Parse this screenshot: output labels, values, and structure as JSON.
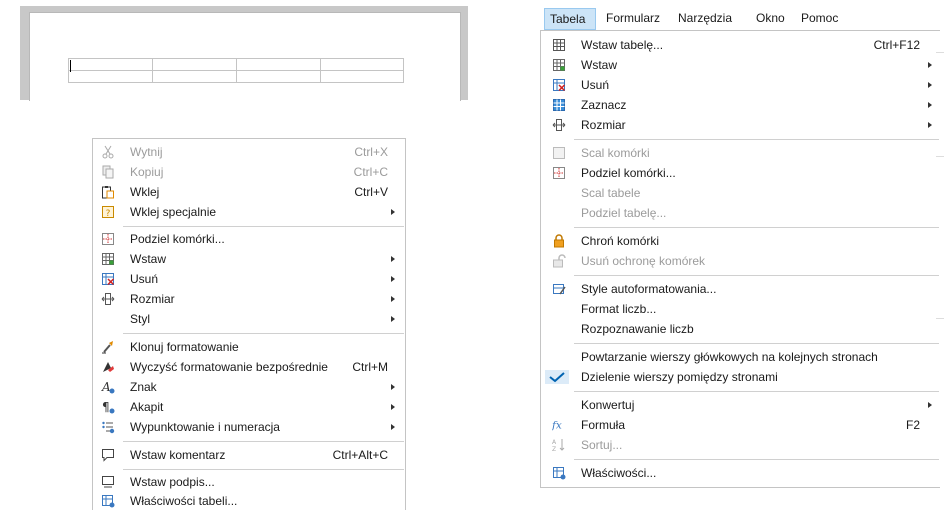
{
  "menubar": {
    "items": [
      {
        "label": "Tabela",
        "active": true
      },
      {
        "label": "Formularz"
      },
      {
        "label": "Narzędzia"
      },
      {
        "label": "Okno"
      },
      {
        "label": "Pomoc"
      }
    ]
  },
  "context_menu": {
    "items": [
      {
        "label": "Wytnij",
        "shortcut": "Ctrl+X",
        "icon": "scissors-icon",
        "disabled": true
      },
      {
        "label": "Kopiuj",
        "shortcut": "Ctrl+C",
        "icon": "copy-icon",
        "disabled": true
      },
      {
        "label": "Wklej",
        "shortcut": "Ctrl+V",
        "icon": "paste-icon"
      },
      {
        "label": "Wklej specjalnie",
        "icon": "paste-special-icon",
        "submenu": true
      },
      {
        "label": "Podziel komórki...",
        "icon": "split-cells-icon"
      },
      {
        "label": "Wstaw",
        "icon": "insert-table-icon",
        "submenu": true
      },
      {
        "label": "Usuń",
        "icon": "delete-table-icon",
        "submenu": true
      },
      {
        "label": "Rozmiar",
        "icon": "resize-icon",
        "submenu": true
      },
      {
        "label": "Styl",
        "submenu": true
      },
      {
        "label": "Klonuj formatowanie",
        "icon": "clone-brush-icon"
      },
      {
        "label": "Wyczyść formatowanie bezpośrednie",
        "shortcut": "Ctrl+M",
        "icon": "clear-format-icon"
      },
      {
        "label": "Znak",
        "icon": "character-icon",
        "submenu": true
      },
      {
        "label": "Akapit",
        "icon": "paragraph-icon",
        "submenu": true
      },
      {
        "label": "Wypunktowanie i numeracja",
        "icon": "bullets-icon",
        "submenu": true
      },
      {
        "label": "Wstaw komentarz",
        "shortcut": "Ctrl+Alt+C",
        "icon": "comment-icon"
      },
      {
        "label": "Wstaw podpis...",
        "icon": "caption-icon"
      },
      {
        "label": "Właściwości tabeli...",
        "icon": "table-properties-icon"
      }
    ]
  },
  "table_menu": {
    "items": [
      {
        "label": "Wstaw tabelę...",
        "shortcut": "Ctrl+F12",
        "icon": "table-icon"
      },
      {
        "label": "Wstaw",
        "icon": "insert-table-icon",
        "submenu": true
      },
      {
        "label": "Usuń",
        "icon": "delete-table-icon",
        "submenu": true
      },
      {
        "label": "Zaznacz",
        "icon": "select-table-icon",
        "submenu": true
      },
      {
        "label": "Rozmiar",
        "icon": "resize-icon",
        "submenu": true
      },
      {
        "label": "Scal komórki",
        "icon": "merge-cells-icon",
        "disabled": true
      },
      {
        "label": "Podziel komórki...",
        "icon": "split-cells-icon"
      },
      {
        "label": "Scal tabele",
        "disabled": true
      },
      {
        "label": "Podziel tabelę...",
        "disabled": true
      },
      {
        "label": "Chroń komórki",
        "icon": "lock-icon"
      },
      {
        "label": "Usuń ochronę komórek",
        "icon": "unlock-icon",
        "disabled": true
      },
      {
        "label": "Style autoformatowania...",
        "icon": "autoformat-icon"
      },
      {
        "label": "Format liczb..."
      },
      {
        "label": "Rozpoznawanie liczb"
      },
      {
        "label": "Powtarzanie wierszy główkowych na kolejnych stronach"
      },
      {
        "label": "Dzielenie wierszy pomiędzy stronami",
        "icon": "checkmark-icon",
        "checked": true
      },
      {
        "label": "Konwertuj",
        "submenu": true
      },
      {
        "label": "Formuła",
        "shortcut": "F2",
        "icon": "fx-icon"
      },
      {
        "label": "Sortuj...",
        "icon": "sort-icon",
        "disabled": true
      },
      {
        "label": "Właściwości...",
        "icon": "table-properties-icon"
      }
    ]
  },
  "colors": {
    "menubar_active_bg": "#cce4f7",
    "menubar_active_border": "#99c9ef",
    "disabled_text": "#9b9b9b",
    "checkmark": "#0063b1"
  }
}
